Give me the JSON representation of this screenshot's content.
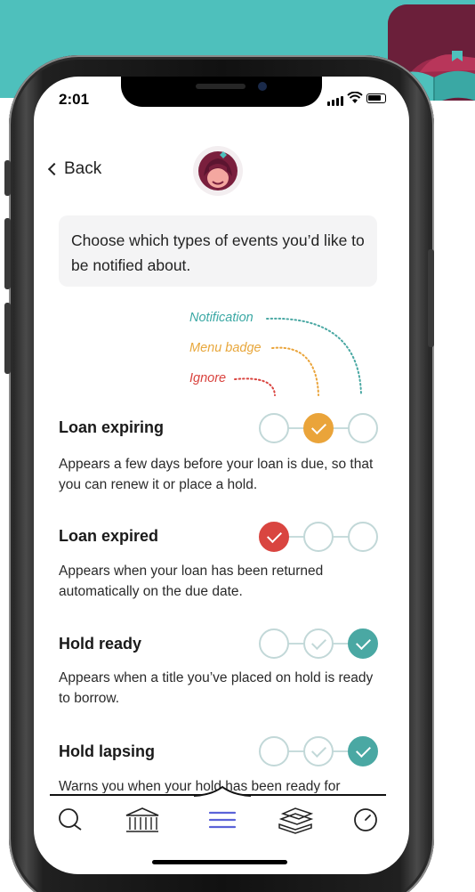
{
  "status_bar": {
    "time": "2:01"
  },
  "nav": {
    "back_label": "Back"
  },
  "intro_text": "Choose which types of events you’d like to be notified about.",
  "legend": {
    "notification": "Notification",
    "menu_badge": "Menu badge",
    "ignore": "Ignore"
  },
  "events": [
    {
      "title": "Loan expiring",
      "description": "Appears a few days before your loan is due, so that you can renew it or place a hold.",
      "selected": "Menu badge"
    },
    {
      "title": "Loan expired",
      "description": "Appears when your loan has been returned automatically on the due date.",
      "selected": "Ignore"
    },
    {
      "title": "Hold ready",
      "description": "Appears when a title you’ve placed on hold is ready to borrow.",
      "selected": "Notification"
    },
    {
      "title": "Hold lapsing",
      "description": "Warns you when your hold has been ready for",
      "selected": "Notification"
    }
  ],
  "colors": {
    "ignore": "#d94540",
    "menu_badge": "#eaa43a",
    "notification": "#4aa8a3",
    "brand_teal": "#4ec0bc",
    "brand_maroon": "#6b1f3a"
  },
  "tab_bar": [
    {
      "icon": "search-icon"
    },
    {
      "icon": "library-icon"
    },
    {
      "icon": "menu-icon",
      "active": true
    },
    {
      "icon": "shelf-books-icon"
    },
    {
      "icon": "clock-icon"
    }
  ]
}
